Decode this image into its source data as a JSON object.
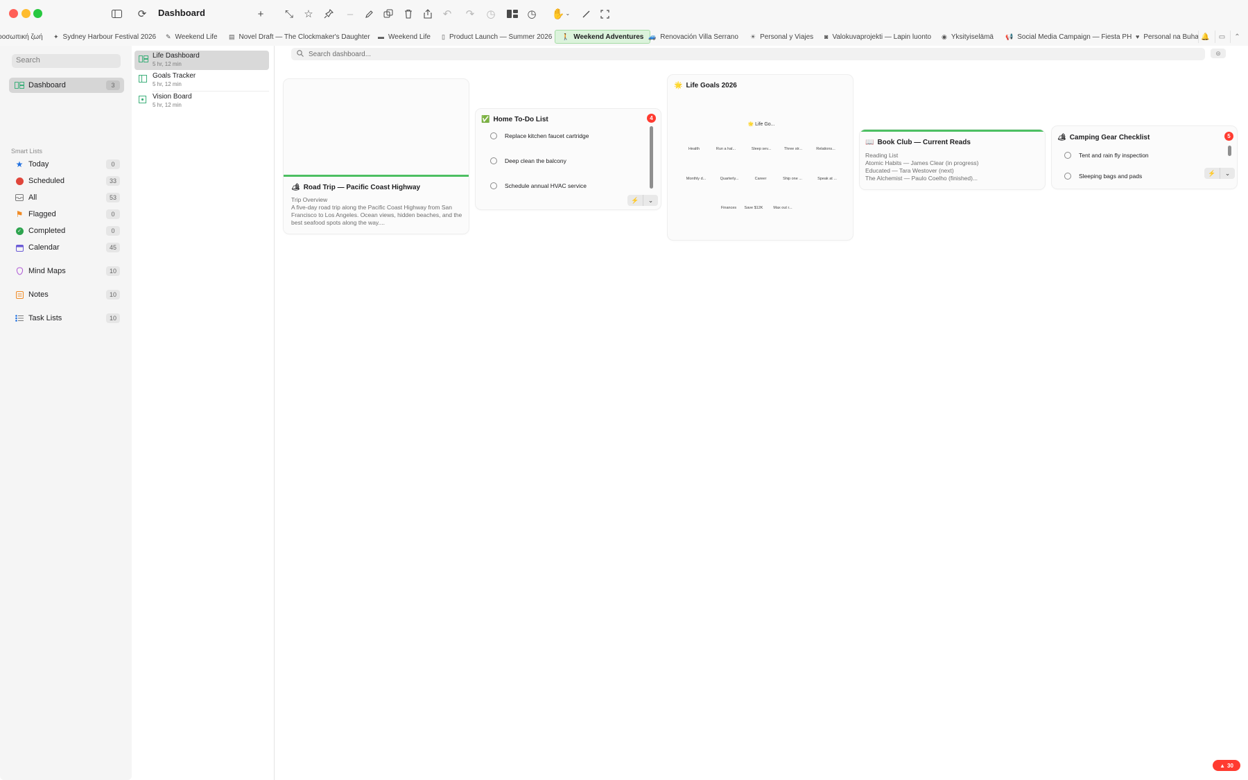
{
  "window": {
    "title": "Dashboard"
  },
  "tabs": [
    {
      "label": "ροσωπική ζωή",
      "icon": "",
      "active": false
    },
    {
      "label": "Sydney Harbour Festival 2026",
      "icon": "sparkle-icon",
      "active": false
    },
    {
      "label": "Weekend Life",
      "icon": "pencil-icon",
      "active": false
    },
    {
      "label": "Novel Draft — The Clockmaker's Daughter",
      "icon": "book-icon",
      "active": false
    },
    {
      "label": "Weekend Life",
      "icon": "bed-icon",
      "active": false
    },
    {
      "label": "Product Launch — Summer 2026",
      "icon": "doc-icon",
      "active": false
    },
    {
      "label": "Weekend Adventures",
      "icon": "hiker-icon",
      "active": true
    },
    {
      "label": "Renovación Villa Serrano",
      "icon": "car-icon",
      "active": false
    },
    {
      "label": "Personal y Viajes",
      "icon": "sun-icon",
      "active": false
    },
    {
      "label": "Valokuvaprojekti — Lapin luonto",
      "icon": "camera-icon",
      "active": false
    },
    {
      "label": "Yksityiselämä",
      "icon": "globe-icon",
      "active": false
    },
    {
      "label": "Social Media Campaign — Fiesta PH",
      "icon": "megaphone-icon",
      "active": false
    },
    {
      "label": "Personal na Buha",
      "icon": "heart-icon",
      "active": false
    }
  ],
  "sidebar": {
    "search_placeholder": "Search",
    "dashboard": {
      "label": "Dashboard",
      "count": "3"
    },
    "smart_lists_header": "Smart Lists",
    "smart_lists": [
      {
        "label": "Today",
        "count": "0",
        "icon": "star-icon",
        "color": "#1e6fe0"
      },
      {
        "label": "Scheduled",
        "count": "33",
        "icon": "clock-icon",
        "color": "#e0463b"
      },
      {
        "label": "All",
        "count": "53",
        "icon": "tray-icon",
        "color": "#7a7a7a"
      },
      {
        "label": "Flagged",
        "count": "0",
        "icon": "flag-icon",
        "color": "#f08a24"
      },
      {
        "label": "Completed",
        "count": "0",
        "icon": "check-circle-icon",
        "color": "#2ea44f"
      },
      {
        "label": "Calendar",
        "count": "45",
        "icon": "calendar-icon",
        "color": "#6b5bd6"
      }
    ],
    "other_lists": [
      {
        "label": "Mind Maps",
        "count": "10",
        "icon": "mind-map-icon",
        "color": "#b05bd6"
      },
      {
        "label": "Notes",
        "count": "10",
        "icon": "notes-icon",
        "color": "#f08a24"
      },
      {
        "label": "Task Lists",
        "count": "10",
        "icon": "task-list-icon",
        "color": "#1e6fe0"
      }
    ]
  },
  "dashboards": [
    {
      "title": "Life Dashboard",
      "subtitle": "5 hr, 12 min",
      "selected": true
    },
    {
      "title": "Goals Tracker",
      "subtitle": "5 hr, 12 min",
      "selected": false
    },
    {
      "title": "Vision Board",
      "subtitle": "5 hr, 12 min",
      "selected": false
    }
  ],
  "main": {
    "search_placeholder": "Search dashboard..."
  },
  "cards": {
    "road_trip": {
      "emoji": "🏕",
      "title": "Road Trip — Pacific Coast Highway",
      "subtitle": "Trip Overview",
      "body": "A five-day road trip along the Pacific Coast Highway from San Francisco to Los Angeles. Ocean views, hidden beaches, and the best seafood spots along the way...."
    },
    "home_todo": {
      "emoji": "✅",
      "title": "Home To-Do List",
      "badge": "4",
      "items": [
        "Replace kitchen faucet cartridge",
        "Deep clean the balcony",
        "Schedule annual HVAC service"
      ]
    },
    "life_goals": {
      "emoji": "🌟",
      "title": "Life Goals 2026",
      "center": "🌟 Life Go...",
      "nodes_row1": [
        "Health",
        "Run a hal...",
        "Sleep sev...",
        "Three str...",
        "Relations..."
      ],
      "nodes_row2": [
        "Monthly d...",
        "Quarterly...",
        "Career",
        "Ship one ...",
        "Speak at ..."
      ],
      "nodes_row3": [
        "Finances",
        "Save $12K",
        "Max out r..."
      ]
    },
    "book_club": {
      "emoji": "📖",
      "title": "Book Club — Current Reads",
      "lines": [
        "Reading List",
        "Atomic Habits — James Clear (in progress)",
        "Educated — Tara Westover (next)",
        "The Alchemist — Paulo Coelho (finished)..."
      ]
    },
    "camping": {
      "emoji": "🏕",
      "title": "Camping Gear Checklist",
      "badge": "5",
      "items": [
        "Tent and rain fly inspection",
        "Sleeping bags and pads"
      ]
    }
  },
  "status": {
    "badge": "30"
  },
  "colors": {
    "accent_green": "#4cbf62",
    "badge_red": "#ff3b30",
    "active_tab_bg": "#dcf3dc"
  }
}
